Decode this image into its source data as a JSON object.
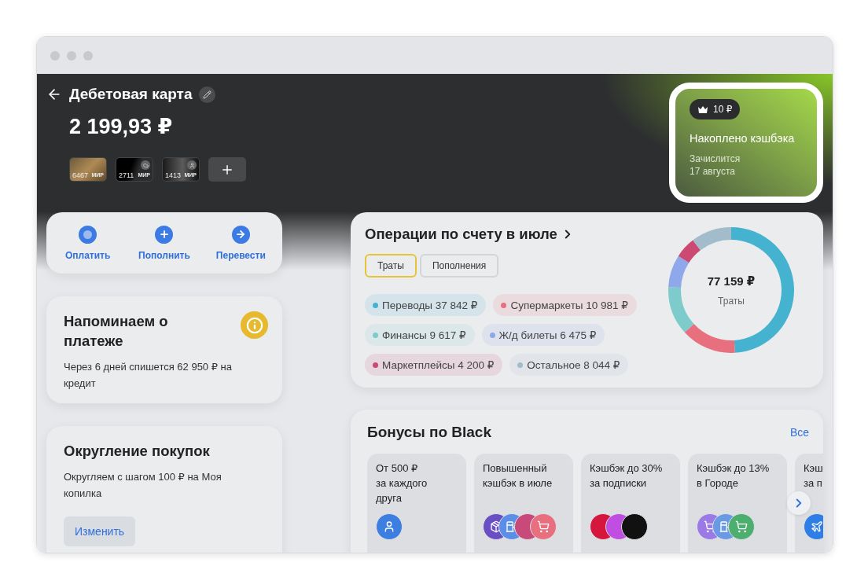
{
  "header": {
    "title": "Дебетовая карта",
    "balance": "2 199,93 ₽",
    "cards": [
      {
        "number": "6467",
        "brand": "МИР",
        "kind": "photo"
      },
      {
        "number": "2711",
        "brand": "МИР",
        "kind": "dark"
      },
      {
        "number": "1413",
        "brand": "МИР",
        "kind": "cat"
      }
    ]
  },
  "cashback": {
    "amount": "10 ₽",
    "title": "Накоплено кэшбэка",
    "note": "Зачислится\n17 августа"
  },
  "actions": [
    {
      "label": "Оплатить",
      "kind": "pay"
    },
    {
      "label": "Пополнить",
      "kind": "topup"
    },
    {
      "label": "Перевести",
      "kind": "transfer"
    }
  ],
  "reminder": {
    "title": "Напоминаем о платеже",
    "text": "Через 6 дней спишется 62 950 ₽ на кредит"
  },
  "rounding": {
    "title": "Округление покупок",
    "text": "Округляем с шагом 100 ₽ на Моя копилка",
    "button": "Изменить"
  },
  "operations": {
    "title": "Операции по счету в июле",
    "tabs": [
      {
        "label": "Траты",
        "selected": true
      },
      {
        "label": "Пополнения",
        "selected": false
      }
    ],
    "chips": [
      {
        "label": "Переводы 37 842 ₽",
        "color": "#45b3d0"
      },
      {
        "label": "Супермаркеты 10 981 ₽",
        "color": "#e8707e"
      },
      {
        "label": "Финансы 9 617 ₽",
        "color": "#7ecbcb"
      },
      {
        "label": "Ж/д билеты 6 475 ₽",
        "color": "#8fa8ec"
      },
      {
        "label": "Маркетплейсы 4 200 ₽",
        "color": "#cc4a72"
      },
      {
        "label": "Остальное 8 044 ₽",
        "color": "#a3bccb"
      }
    ],
    "center_value": "77 159 ₽",
    "center_label": "Траты",
    "chart_data": {
      "type": "donut",
      "values": [
        49.04,
        14.23,
        12.46,
        8.39,
        5.44,
        10.44
      ]
    }
  },
  "bonuses": {
    "title": "Бонусы по Black",
    "link": "Все",
    "items": [
      {
        "text": "От 500 ₽\nза каждого\nдруга"
      },
      {
        "text": "Повышенный\nкэшбэк в июле"
      },
      {
        "text": "Кэшбэк до 30%\nза подписки"
      },
      {
        "text": "Кэшбэк до 13%\nв Городе"
      },
      {
        "text": "Кэш\nза п"
      }
    ]
  }
}
